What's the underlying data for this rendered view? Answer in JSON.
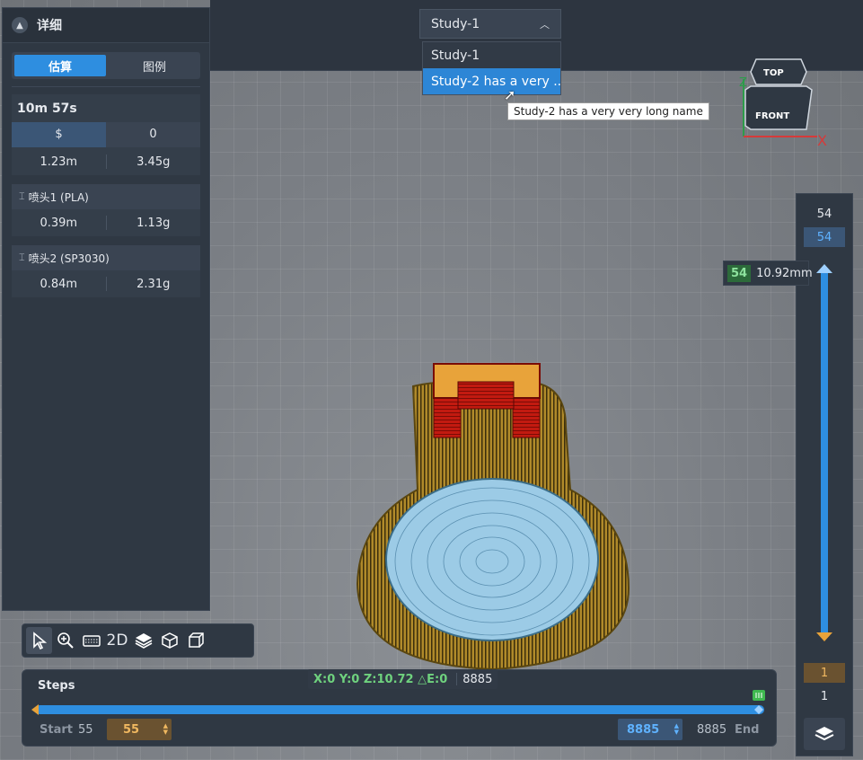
{
  "details_panel": {
    "title": "详细",
    "tabs": [
      {
        "label": "估算",
        "active": true
      },
      {
        "label": "图例",
        "active": false
      }
    ],
    "total_time": "10m 57s",
    "cost_row": [
      "$",
      "0"
    ],
    "total_row": [
      "1.23m",
      "3.45g"
    ],
    "nozzles": [
      {
        "label": "喷头1 (PLA)",
        "values": [
          "0.39m",
          "1.13g"
        ]
      },
      {
        "label": "喷头2 (SP3030)",
        "values": [
          "0.84m",
          "2.31g"
        ]
      }
    ]
  },
  "study": {
    "selected": "Study-1",
    "options": [
      "Study-1",
      "Study-2 has a very ..."
    ],
    "tooltip": "Study-2 has a very very long name"
  },
  "viewcube": {
    "top": "TOP",
    "front": "FRONT",
    "z_axis": "Z",
    "x_axis": "X"
  },
  "layer_slider": {
    "max_layer": "54",
    "current_top": "54",
    "tip_layer": "54",
    "tip_height": "10.92mm",
    "current_bottom": "1",
    "min_layer": "1"
  },
  "toolbar": {
    "tools": [
      "select-icon",
      "zoom-icon",
      "keyboard-icon",
      "2d-view-icon",
      "layers-icon",
      "cube-icon",
      "perspective-icon"
    ],
    "two_d_label": "2D"
  },
  "steps": {
    "title": "Steps",
    "coords": "X:0 Y:0 Z:10.72 △E:0",
    "coord_step": "8885",
    "start_label": "Start",
    "start_value": "55",
    "start_input": "55",
    "end_input": "8885",
    "end_value": "8885",
    "end_label": "End"
  },
  "colors": {
    "accent": "#2e8ee0",
    "panel": "#2f3843",
    "orange": "#e8a33a"
  }
}
